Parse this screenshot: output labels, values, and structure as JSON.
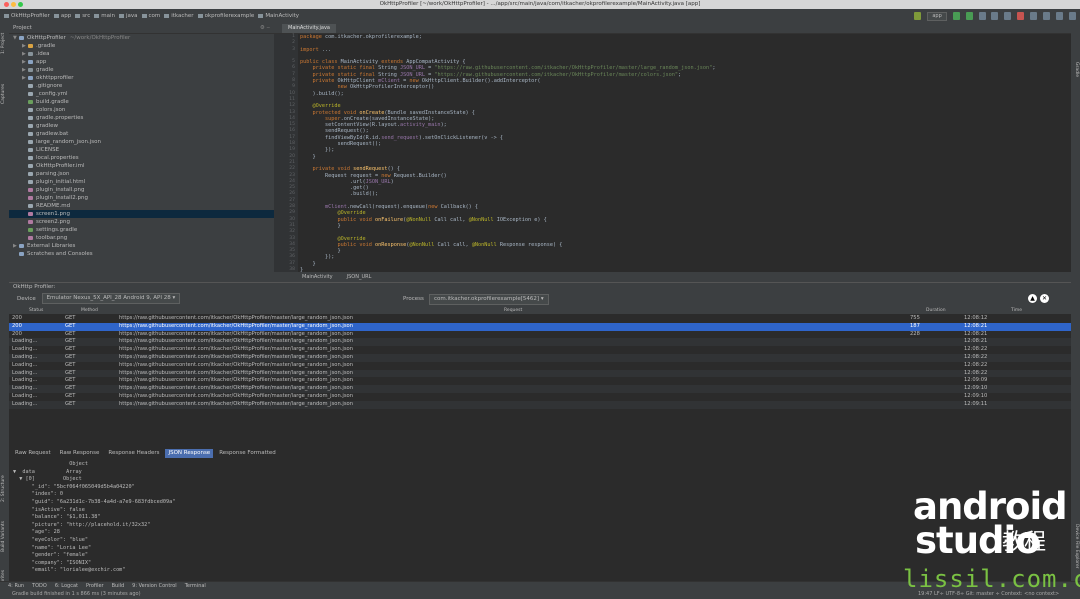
{
  "window_title": "OkHttpProfiler [~/work/OkHttpProfiler] - .../app/src/main/java/com/itkacher/okprofilerexample/MainActivity.java [app]",
  "breadcrumbs": [
    "OkHttpProfiler",
    "app",
    "src",
    "main",
    "java",
    "com",
    "itkacher",
    "okprofilerexample",
    "MainActivity"
  ],
  "toolbar": {
    "config": "app"
  },
  "left_tools": [
    "1: Project",
    "Captures",
    "2: Structure",
    "Build Variants",
    "2: Favorites"
  ],
  "right_tools": [
    "Gradle",
    "Device File Explorer"
  ],
  "project": {
    "title": "Project",
    "tree": [
      {
        "label": "OkHttpProfiler",
        "extra": "~/work/OkHttpProfiler",
        "depth": 0,
        "arrow": "▼",
        "kind": "module"
      },
      {
        "label": ".gradle",
        "depth": 1,
        "arrow": "▶",
        "kind": "folder-orange"
      },
      {
        "label": ".idea",
        "depth": 1,
        "arrow": "▶",
        "kind": "folder"
      },
      {
        "label": "app",
        "depth": 1,
        "arrow": "▶",
        "kind": "module"
      },
      {
        "label": "gradle",
        "depth": 1,
        "arrow": "▶",
        "kind": "folder"
      },
      {
        "label": "okhttpprofiler",
        "depth": 1,
        "arrow": "▶",
        "kind": "module"
      },
      {
        "label": ".gitignore",
        "depth": 1,
        "arrow": "",
        "kind": "file"
      },
      {
        "label": "_config.yml",
        "depth": 1,
        "arrow": "",
        "kind": "file"
      },
      {
        "label": "build.gradle",
        "depth": 1,
        "arrow": "",
        "kind": "gradle"
      },
      {
        "label": "colors.json",
        "depth": 1,
        "arrow": "",
        "kind": "file"
      },
      {
        "label": "gradle.properties",
        "depth": 1,
        "arrow": "",
        "kind": "file"
      },
      {
        "label": "gradlew",
        "depth": 1,
        "arrow": "",
        "kind": "file"
      },
      {
        "label": "gradlew.bat",
        "depth": 1,
        "arrow": "",
        "kind": "file"
      },
      {
        "label": "large_random_json.json",
        "depth": 1,
        "arrow": "",
        "kind": "file"
      },
      {
        "label": "LICENSE",
        "depth": 1,
        "arrow": "",
        "kind": "file"
      },
      {
        "label": "local.properties",
        "depth": 1,
        "arrow": "",
        "kind": "file"
      },
      {
        "label": "OkHttpProfiler.iml",
        "depth": 1,
        "arrow": "",
        "kind": "file"
      },
      {
        "label": "parsing.json",
        "depth": 1,
        "arrow": "",
        "kind": "file"
      },
      {
        "label": "plugin_initial.html",
        "depth": 1,
        "arrow": "",
        "kind": "file"
      },
      {
        "label": "plugin_install.png",
        "depth": 1,
        "arrow": "",
        "kind": "image"
      },
      {
        "label": "plugin_install2.png",
        "depth": 1,
        "arrow": "",
        "kind": "image"
      },
      {
        "label": "README.md",
        "depth": 1,
        "arrow": "",
        "kind": "file"
      },
      {
        "label": "screen1.png",
        "depth": 1,
        "arrow": "",
        "kind": "image",
        "selected": true
      },
      {
        "label": "screen2.png",
        "depth": 1,
        "arrow": "",
        "kind": "image"
      },
      {
        "label": "settings.gradle",
        "depth": 1,
        "arrow": "",
        "kind": "gradle"
      },
      {
        "label": "toolbar.png",
        "depth": 1,
        "arrow": "",
        "kind": "image"
      },
      {
        "label": "External Libraries",
        "depth": 0,
        "arrow": "▶",
        "kind": "lib"
      },
      {
        "label": "Scratches and Consoles",
        "depth": 0,
        "arrow": "",
        "kind": "lib"
      }
    ]
  },
  "editor": {
    "tab": "MainActivity.java",
    "bottom_tabs": [
      "MainActivity",
      "JSON_URL"
    ],
    "line_numbers": [
      "1",
      "2",
      "3",
      "",
      "5",
      "6",
      "7",
      "8",
      "9",
      "10",
      "11",
      "12",
      "13",
      "14",
      "15",
      "16",
      "17",
      "18",
      "19",
      "20",
      "21",
      "22",
      "23",
      "24",
      "25",
      "26",
      "27",
      "28",
      "29",
      "30",
      "31",
      "32",
      "33",
      "34",
      "35",
      "36",
      "37",
      "38"
    ]
  },
  "profiler": {
    "title": "OkHttp Profiler:",
    "device_label": "Device",
    "device": "Emulator Nexus_5X_API_28 Android 9, API 28",
    "process_label": "Process",
    "process": "com.itkacher.okprofilerexample[5462]",
    "columns": [
      "Status",
      "Method",
      "Request",
      "Duration",
      "Time"
    ],
    "rows": [
      [
        "200",
        "GET",
        "https://raw.githubusercontent.com/itkacher/OkHttpProfiler/master/large_random_json.json",
        "755",
        "12:08:12"
      ],
      [
        "200",
        "GET",
        "https://raw.githubusercontent.com/itkacher/OkHttpProfiler/master/large_random_json.json",
        "187",
        "12:08:21"
      ],
      [
        "200",
        "GET",
        "https://raw.githubusercontent.com/itkacher/OkHttpProfiler/master/large_random_json.json",
        "228",
        "12:08:21"
      ],
      [
        "Loading...",
        "GET",
        "https://raw.githubusercontent.com/itkacher/OkHttpProfiler/master/large_random_json.json",
        "",
        "12:08:21"
      ],
      [
        "Loading...",
        "GET",
        "https://raw.githubusercontent.com/itkacher/OkHttpProfiler/master/large_random_json.json",
        "",
        "12:08:22"
      ],
      [
        "Loading...",
        "GET",
        "https://raw.githubusercontent.com/itkacher/OkHttpProfiler/master/large_random_json.json",
        "",
        "12:08:22"
      ],
      [
        "Loading...",
        "GET",
        "https://raw.githubusercontent.com/itkacher/OkHttpProfiler/master/large_random_json.json",
        "",
        "12:08:22"
      ],
      [
        "Loading...",
        "GET",
        "https://raw.githubusercontent.com/itkacher/OkHttpProfiler/master/large_random_json.json",
        "",
        "12:08:22"
      ],
      [
        "Loading...",
        "GET",
        "https://raw.githubusercontent.com/itkacher/OkHttpProfiler/master/large_random_json.json",
        "",
        "12:09:09"
      ],
      [
        "Loading...",
        "GET",
        "https://raw.githubusercontent.com/itkacher/OkHttpProfiler/master/large_random_json.json",
        "",
        "12:09:10"
      ],
      [
        "Loading...",
        "GET",
        "https://raw.githubusercontent.com/itkacher/OkHttpProfiler/master/large_random_json.json",
        "",
        "12:09:10"
      ],
      [
        "Loading...",
        "GET",
        "https://raw.githubusercontent.com/itkacher/OkHttpProfiler/master/large_random_json.json",
        "",
        "12:09:11"
      ]
    ],
    "selected_row": 1,
    "response_tabs": [
      "Raw Request",
      "Raw Response",
      "Response Headers",
      "JSON Response",
      "Response Formatted"
    ],
    "active_tab": 3
  },
  "json_lines": [
    "                  Object",
    "▼  data          Array",
    "  ▼ [0]         Object",
    "      \"_id\": \"5bcf064f065049d5b4a04220\"",
    "      \"index\": 0",
    "      \"guid\": \"6a231d1c-7b38-4a4d-a7e9-683fdbced09a\"",
    "      \"isActive\": false",
    "      \"balance\": \"$1,011.38\"",
    "      \"picture\": \"http://placehold.it/32x32\"",
    "      \"age\": 28",
    "      \"eyeColor\": \"blue\"",
    "      \"name\": \"Loria Lee\"",
    "      \"gender\": \"female\"",
    "      \"company\": \"ISONIX\"",
    "      \"email\": \"lorialee@exchir.com\""
  ],
  "bottom_tools": [
    "4: Run",
    "TODO",
    "6: Logcat",
    "Profiler",
    "Build",
    "9: Version Control",
    "Terminal"
  ],
  "status": {
    "message": "Gradle build finished in 1 s 866 ms (3 minutes ago)",
    "right": "19:47  LF÷  UTF-8÷  Git: master ÷  Context: <no context>"
  },
  "watermark": {
    "line1": "android",
    "line2": "studio",
    "cn": "教程",
    "line3": "lissil.com.cn"
  },
  "colors": {
    "selection": "#2f65ca",
    "accent": "#4b6eaf",
    "background": "#2b2b2b",
    "panel": "#3c3f41"
  }
}
